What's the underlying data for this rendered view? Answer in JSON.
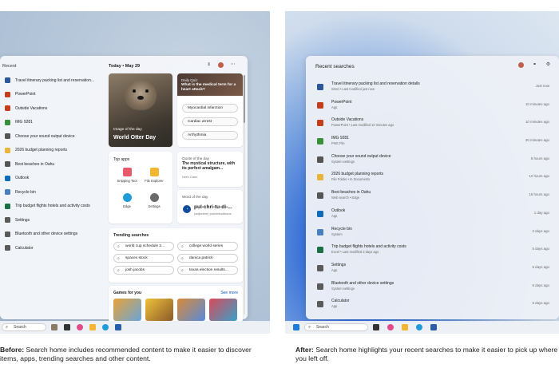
{
  "before": {
    "recent_title": "Recent",
    "recent_items": [
      {
        "label": "Travel itinerary packing list and reservation...",
        "icon": "word-doc-icon",
        "color": "#2b579a"
      },
      {
        "label": "PowerPoint",
        "icon": "powerpoint-icon",
        "color": "#c43e1c"
      },
      {
        "label": "Outside Vacations",
        "icon": "powerpoint-icon",
        "color": "#c43e1c"
      },
      {
        "label": "IMG 9281",
        "icon": "image-file-icon",
        "color": "#3a8f3a"
      },
      {
        "label": "Choose your sound output device",
        "icon": "speaker-icon",
        "color": "#555555"
      },
      {
        "label": "2026 budget planning reports",
        "icon": "folder-icon",
        "color": "#e8b53a"
      },
      {
        "label": "Best beaches in Oahu",
        "icon": "search-icon",
        "color": "#555555"
      },
      {
        "label": "Outlook",
        "icon": "outlook-icon",
        "color": "#0f6cbd"
      },
      {
        "label": "Recycle bin",
        "icon": "recycle-bin-icon",
        "color": "#4a7fbf"
      },
      {
        "label": "Trip budget flights hotels and activity costs",
        "icon": "excel-icon",
        "color": "#1d7044"
      },
      {
        "label": "Settings",
        "icon": "gear-icon",
        "color": "#5a5a5a"
      },
      {
        "label": "Bluetooth and other device settings",
        "icon": "bluetooth-icon",
        "color": "#5a5a5a"
      },
      {
        "label": "Calculator",
        "icon": "calculator-icon",
        "color": "#5a5a5a"
      }
    ],
    "today_label": "Today  •  May 29",
    "image_of_day": {
      "caption": "Image of the day",
      "title": "World Otter Day"
    },
    "quiz": {
      "label": "Daily Quiz",
      "question": "What is the medical term for a heart attack?",
      "options": [
        "Myocardial infarction",
        "Cardiac arrest",
        "Arrhythmia"
      ]
    },
    "top_apps": {
      "title": "Top apps",
      "apps": [
        {
          "label": "Snipping Tool",
          "icon": "snipping-tool-icon",
          "color": "#e85a6b"
        },
        {
          "label": "File Explorer",
          "icon": "file-explorer-icon",
          "color": "#f2b632"
        },
        {
          "label": "Edge",
          "icon": "edge-icon",
          "color": "#1e9bd8"
        },
        {
          "label": "Settings",
          "icon": "gear-icon",
          "color": "#6a6a6a"
        }
      ]
    },
    "quote": {
      "label": "Quote of the day",
      "text": "The mystical structure, with its perfect amalgam...",
      "author": "Herb Caen"
    },
    "word": {
      "label": "Word of the day",
      "word": "pul-chri-tu-di-...",
      "detail": "(adjective) pulchritudinous"
    },
    "trending": {
      "title": "Trending searches",
      "items": [
        "world cup schedule 2...",
        "college world series",
        "spacex stock",
        "danica patrick",
        "josh jacobs",
        "texas election results..."
      ]
    },
    "games": {
      "title": "Games for you",
      "more": "See more"
    },
    "taskbar_search": "Search",
    "caption_bold": "Before:",
    "caption_text": "Search home includes recommended content to make it easier to discover items, apps, trending searches and other content."
  },
  "after": {
    "title": "Recent searches",
    "items": [
      {
        "name": "Travel itinerary packing list and reservation details",
        "sub": "Word • Last modified just now",
        "time": "Just now",
        "icon": "word-doc-icon",
        "color": "#2b579a"
      },
      {
        "name": "PowerPoint",
        "sub": "App",
        "time": "10 minutes ago",
        "icon": "powerpoint-icon",
        "color": "#c43e1c"
      },
      {
        "name": "Outside Vacations",
        "sub": "PowerPoint • Last modified 10 minutes ago",
        "time": "10 minutes ago",
        "icon": "powerpoint-icon",
        "color": "#c43e1c"
      },
      {
        "name": "IMG 9281",
        "sub": "PNG File",
        "time": "20 minutes ago",
        "icon": "image-file-icon",
        "color": "#3a8f3a"
      },
      {
        "name": "Choose your sound output device",
        "sub": "System settings",
        "time": "5 hours ago",
        "icon": "speaker-icon",
        "color": "#555555"
      },
      {
        "name": "2026 budget planning reports",
        "sub": "File Folder • In Documents",
        "time": "12 hours ago",
        "icon": "folder-icon",
        "color": "#e8b53a"
      },
      {
        "name": "Best beaches in Oahu",
        "sub": "Web search • Edge",
        "time": "16 hours ago",
        "icon": "search-icon",
        "color": "#555555"
      },
      {
        "name": "Outlook",
        "sub": "App",
        "time": "1 day ago",
        "icon": "outlook-icon",
        "color": "#0f6cbd"
      },
      {
        "name": "Recycle bin",
        "sub": "System",
        "time": "2 days ago",
        "icon": "recycle-bin-icon",
        "color": "#4a7fbf"
      },
      {
        "name": "Trip budget flights hotels and activity costs",
        "sub": "Excel • Last modified 3 days ago",
        "time": "5 days ago",
        "icon": "excel-icon",
        "color": "#1d7044"
      },
      {
        "name": "Settings",
        "sub": "App",
        "time": "6 days ago",
        "icon": "gear-icon",
        "color": "#5a5a5a"
      },
      {
        "name": "Bluetooth and other device settings",
        "sub": "System settings",
        "time": "6 days ago",
        "icon": "bluetooth-icon",
        "color": "#5a5a5a"
      },
      {
        "name": "Calculator",
        "sub": "App",
        "time": "6 days ago",
        "icon": "calculator-icon",
        "color": "#5a5a5a"
      }
    ],
    "taskbar_search": "Search",
    "caption_bold": "After:",
    "caption_text": "Search home highlights your recent searches to make it easier to pick up where you left off."
  }
}
